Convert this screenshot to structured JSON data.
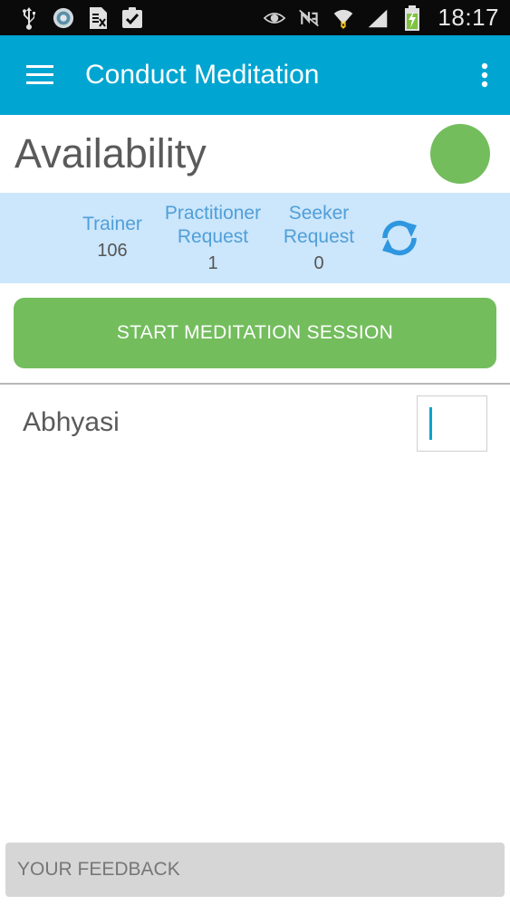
{
  "status_bar": {
    "time": "18:17",
    "icons": [
      "usb-icon",
      "app-badge-icon",
      "storage-icon",
      "clipboard-check-icon",
      "eye-icon",
      "nfc-icon",
      "wifi-icon",
      "signal-icon",
      "battery-charging-icon"
    ]
  },
  "app_bar": {
    "title": "Conduct Meditation",
    "menu_icon": "hamburger-menu-icon",
    "overflow_icon": "more-vert-icon"
  },
  "availability": {
    "title": "Availability",
    "status_color": "#73bd5d"
  },
  "stats": {
    "trainer": {
      "label": "Trainer",
      "value": "106"
    },
    "practitioner": {
      "label_line1": "Practitioner",
      "label_line2": "Request",
      "value": "1"
    },
    "seeker": {
      "label_line1": "Seeker",
      "label_line2": "Request",
      "value": "0"
    },
    "refresh_icon": "refresh-icon"
  },
  "start_button": {
    "label": "START MEDITATION SESSION"
  },
  "abhyasi": {
    "label": "Abhyasi",
    "value": ""
  },
  "feedback": {
    "label": "YOUR FEEDBACK"
  },
  "colors": {
    "primary": "#00a5d1",
    "accent_green": "#73bd5d",
    "stats_bg": "#cce6fb",
    "stats_label": "#4f9fd9"
  }
}
